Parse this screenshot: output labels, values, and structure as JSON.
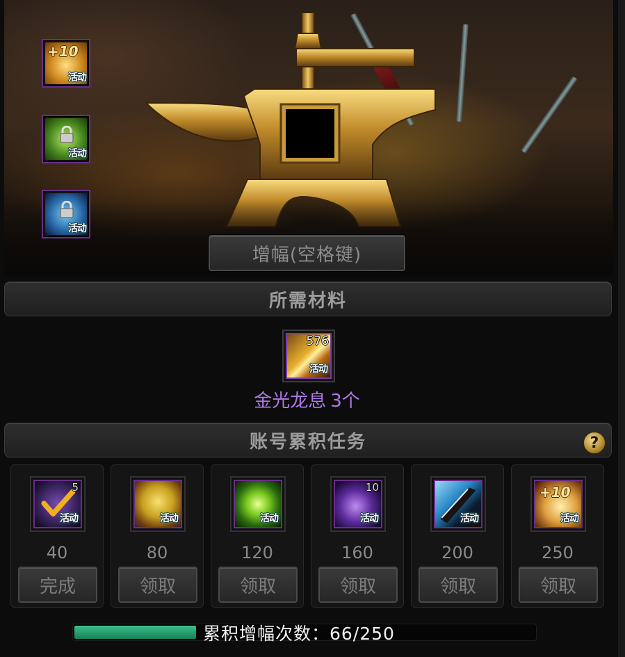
{
  "side_items": [
    {
      "tag": "活动",
      "badge": "+10",
      "kind": "gold-plus",
      "border": "#6a2d8a"
    },
    {
      "tag": "活动",
      "badge": "",
      "kind": "green-lock",
      "border": "#6a2d8a"
    },
    {
      "tag": "活动",
      "badge": "",
      "kind": "blue-lock",
      "border": "#6a2d8a"
    }
  ],
  "main_button": {
    "label": "增幅(空格键)"
  },
  "materials_section": {
    "title": "所需材料"
  },
  "material": {
    "count": "576",
    "tag": "活动",
    "name": "金光龙息",
    "quantity": "3个",
    "name_color": "#b07ae8"
  },
  "tasks_section": {
    "title": "账号累积任务",
    "help": "?"
  },
  "rewards": [
    {
      "count": "5",
      "tag": "活动",
      "threshold": "40",
      "button": "完成",
      "kind": "purple-check"
    },
    {
      "count": "",
      "tag": "活动",
      "threshold": "80",
      "button": "领取",
      "kind": "gold-web"
    },
    {
      "count": "",
      "tag": "活动",
      "threshold": "120",
      "button": "领取",
      "kind": "green-orb"
    },
    {
      "count": "10",
      "tag": "活动",
      "threshold": "160",
      "button": "领取",
      "kind": "purple-orb"
    },
    {
      "count": "",
      "tag": "活动",
      "threshold": "200",
      "button": "领取",
      "kind": "blade"
    },
    {
      "count": "",
      "tag": "活动",
      "threshold": "250",
      "button": "领取",
      "kind": "gold-plus",
      "badge": "+10"
    }
  ],
  "progress": {
    "label": "累积增幅次数：66/250",
    "current": 66,
    "total": 250,
    "color": "#2fa878"
  }
}
